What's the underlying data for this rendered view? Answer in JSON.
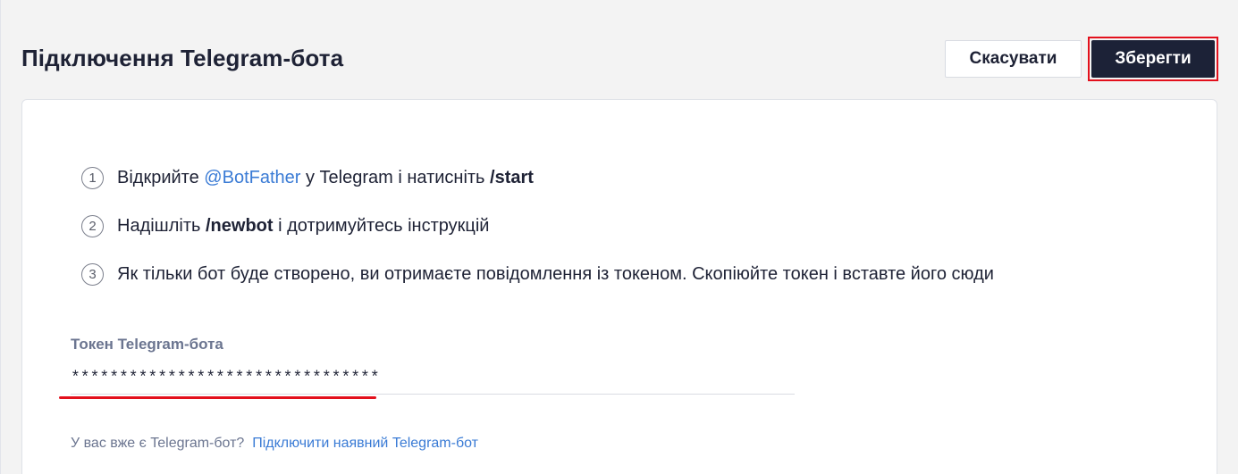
{
  "header": {
    "title": "Підключення Telegram-бота",
    "cancel_label": "Скасувати",
    "save_label": "Зберегти"
  },
  "steps": [
    {
      "number": "1",
      "text_before": "Відкрийте ",
      "link": "@BotFather",
      "text_middle": " у Telegram і натисніть ",
      "command": "/start"
    },
    {
      "number": "2",
      "text_before": "Надішліть ",
      "command": "/newbot",
      "text_after": " і дотримуйтесь інструкцій"
    },
    {
      "number": "3",
      "text": "Як тільки бот буде створено, ви отримаєте повідомлення із токеном. Скопіюйте токен і вставте його сюди"
    }
  ],
  "token_field": {
    "label": "Токен Telegram-бота",
    "value": "********************************"
  },
  "footer": {
    "question": "У вас вже є Telegram-бот? ",
    "link": "Підключити наявний Telegram-бот"
  },
  "colors": {
    "primary_button": "#1c2237",
    "link": "#3a7bd5",
    "highlight": "#e3101c"
  }
}
